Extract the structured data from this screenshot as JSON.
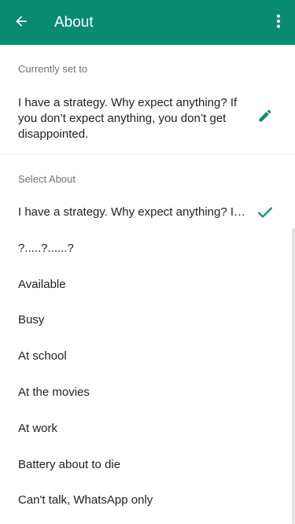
{
  "header": {
    "title": "About",
    "back_icon": "arrow-back-icon",
    "menu_icon": "more-vert-icon",
    "color": "#0a8a73"
  },
  "current": {
    "label": "Currently set to",
    "text": "I have a strategy. Why expect anything? If you don’t expect anything, you don’t get disappointed.",
    "edit_icon": "pencil-icon",
    "accent": "#0a8a73"
  },
  "select": {
    "label": "Select About",
    "options": [
      {
        "label": "I have a strategy. Why expect anything? If you don’t expect anything, you don’t get disappointed.",
        "selected": true
      },
      {
        "label": "?.....?......?",
        "selected": false
      },
      {
        "label": "Available",
        "selected": false
      },
      {
        "label": "Busy",
        "selected": false
      },
      {
        "label": "At school",
        "selected": false
      },
      {
        "label": "At the movies",
        "selected": false
      },
      {
        "label": "At work",
        "selected": false
      },
      {
        "label": "Battery about to die",
        "selected": false
      },
      {
        "label": "Can't talk, WhatsApp only",
        "selected": false
      }
    ],
    "check_icon": "check-icon"
  }
}
